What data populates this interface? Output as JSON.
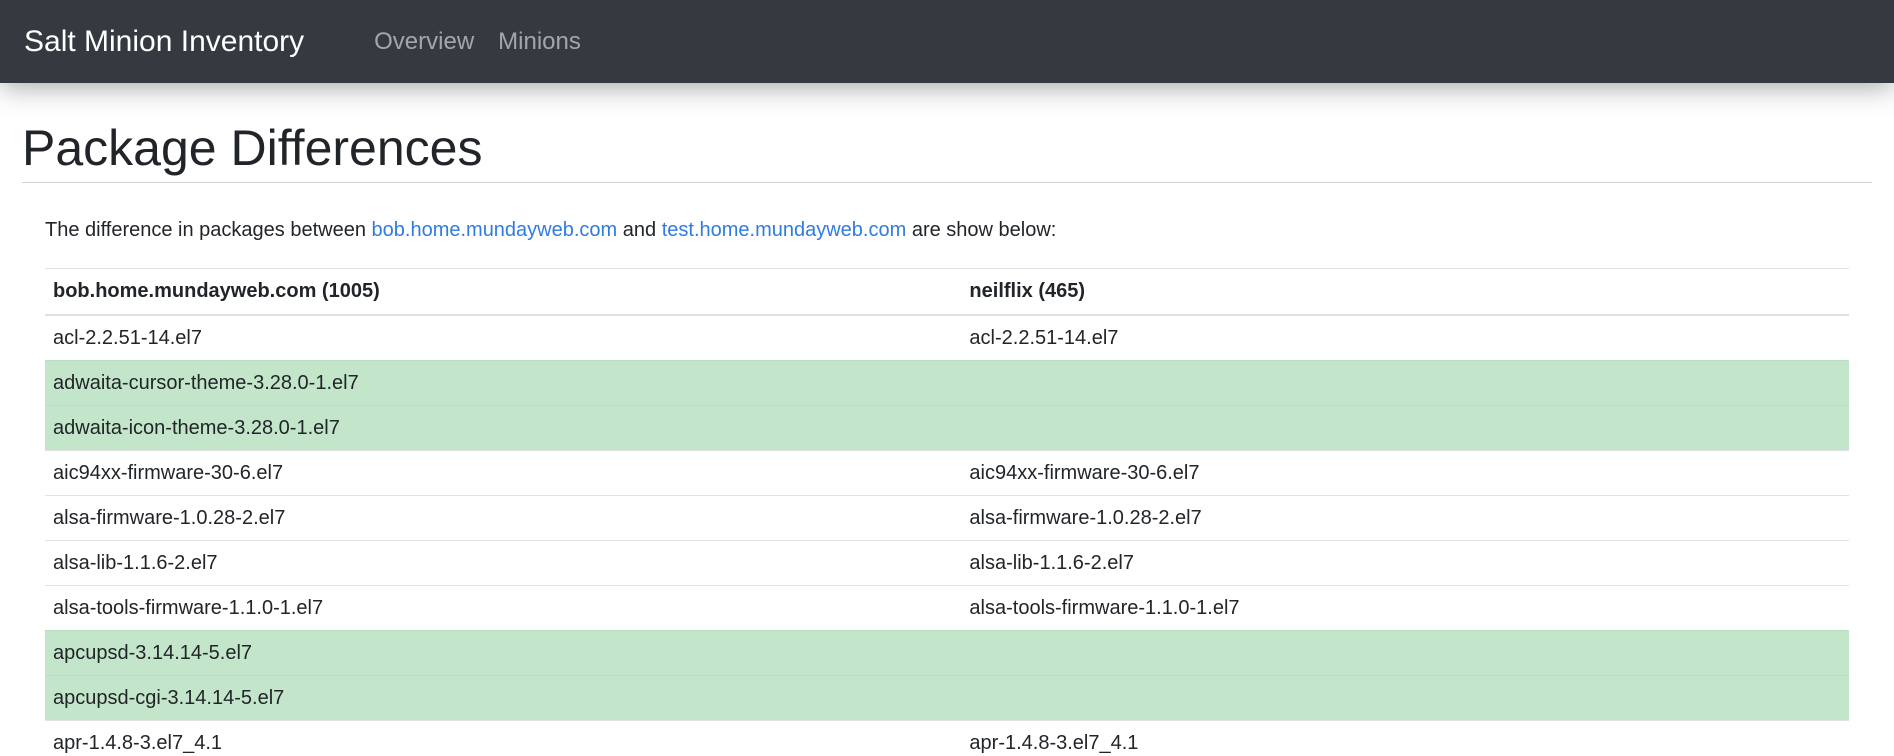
{
  "nav": {
    "brand": "Salt Minion Inventory",
    "links": [
      {
        "label": "Overview"
      },
      {
        "label": "Minions"
      }
    ]
  },
  "page": {
    "title": "Package Differences",
    "intro_prefix": "The difference in packages between ",
    "minion_a_link": "bob.home.mundayweb.com",
    "intro_middle": " and ",
    "minion_b_link": "test.home.mundayweb.com",
    "intro_suffix": " are show below:"
  },
  "colors": {
    "navbar_bg": "#343a40",
    "link": "#2f7ce0",
    "diff_row_bg": "#c3e6cb"
  },
  "table": {
    "headers": [
      "bob.home.mundayweb.com (1005)",
      "neilflix (465)"
    ],
    "rows": [
      {
        "left": "acl-2.2.51-14.el7",
        "right": "acl-2.2.51-14.el7",
        "diff": false
      },
      {
        "left": "adwaita-cursor-theme-3.28.0-1.el7",
        "right": "",
        "diff": true
      },
      {
        "left": "adwaita-icon-theme-3.28.0-1.el7",
        "right": "",
        "diff": true
      },
      {
        "left": "aic94xx-firmware-30-6.el7",
        "right": "aic94xx-firmware-30-6.el7",
        "diff": false
      },
      {
        "left": "alsa-firmware-1.0.28-2.el7",
        "right": "alsa-firmware-1.0.28-2.el7",
        "diff": false
      },
      {
        "left": "alsa-lib-1.1.6-2.el7",
        "right": "alsa-lib-1.1.6-2.el7",
        "diff": false
      },
      {
        "left": "alsa-tools-firmware-1.1.0-1.el7",
        "right": "alsa-tools-firmware-1.1.0-1.el7",
        "diff": false
      },
      {
        "left": "apcupsd-3.14.14-5.el7",
        "right": "",
        "diff": true
      },
      {
        "left": "apcupsd-cgi-3.14.14-5.el7",
        "right": "",
        "diff": true
      },
      {
        "left": "apr-1.4.8-3.el7_4.1",
        "right": "apr-1.4.8-3.el7_4.1",
        "diff": false
      }
    ]
  }
}
